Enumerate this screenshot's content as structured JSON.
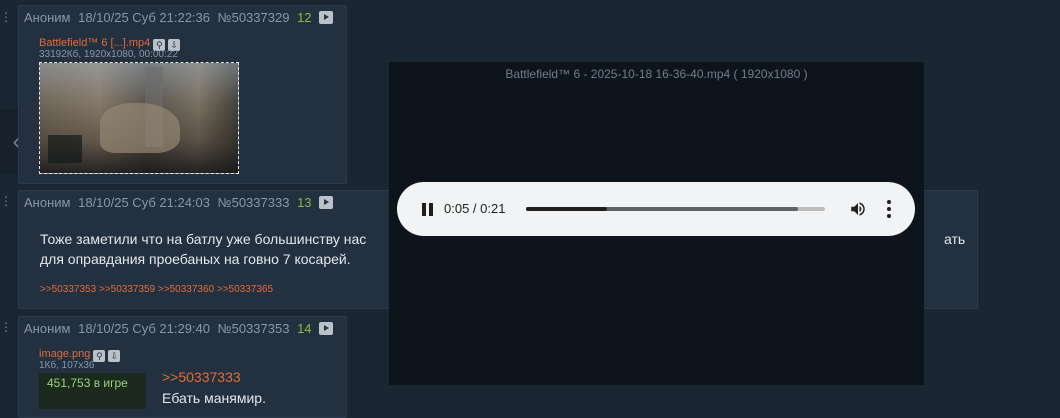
{
  "posts": [
    {
      "author": "Аноним",
      "datetime": "18/10/25 Суб 21:22:36",
      "number": "№50337329",
      "reply_count": "12",
      "file_name": "Battlefield™ 6 [...].mp4",
      "file_meta": "33192Кб, 1920x1080, 00:00:22"
    },
    {
      "author": "Аноним",
      "datetime": "18/10/25 Суб 21:24:03",
      "number": "№50337333",
      "reply_count": "13",
      "text_line1": "Тоже заметили что на батлу уже большинству нас",
      "text_line1_tail": "ать",
      "text_line2": "для оправдания проебаных на говно 7 косарей.",
      "backlinks": ">>50337353 >>50337359 >>50337360 >>50337365"
    },
    {
      "author": "Аноним",
      "datetime": "18/10/25 Суб 21:29:40",
      "number": "№50337353",
      "reply_count": "14",
      "file_name": "image.png",
      "file_meta": "1Кб, 107x36",
      "thumb_text": "451,753 в игре",
      "reply_to": ">>50337333",
      "text": "Ебать манямир."
    }
  ],
  "modal": {
    "title": "Battlefield™ 6 - 2025-10-18 16-36-40.mp4 ( 1920x1080 )",
    "time": "0:05 / 0:21",
    "progress": 0.27,
    "buffered": 0.91
  },
  "colors": {
    "accent_link": "#e06c3a",
    "reply_count": "#8fb93c",
    "background": "#1b2633"
  }
}
